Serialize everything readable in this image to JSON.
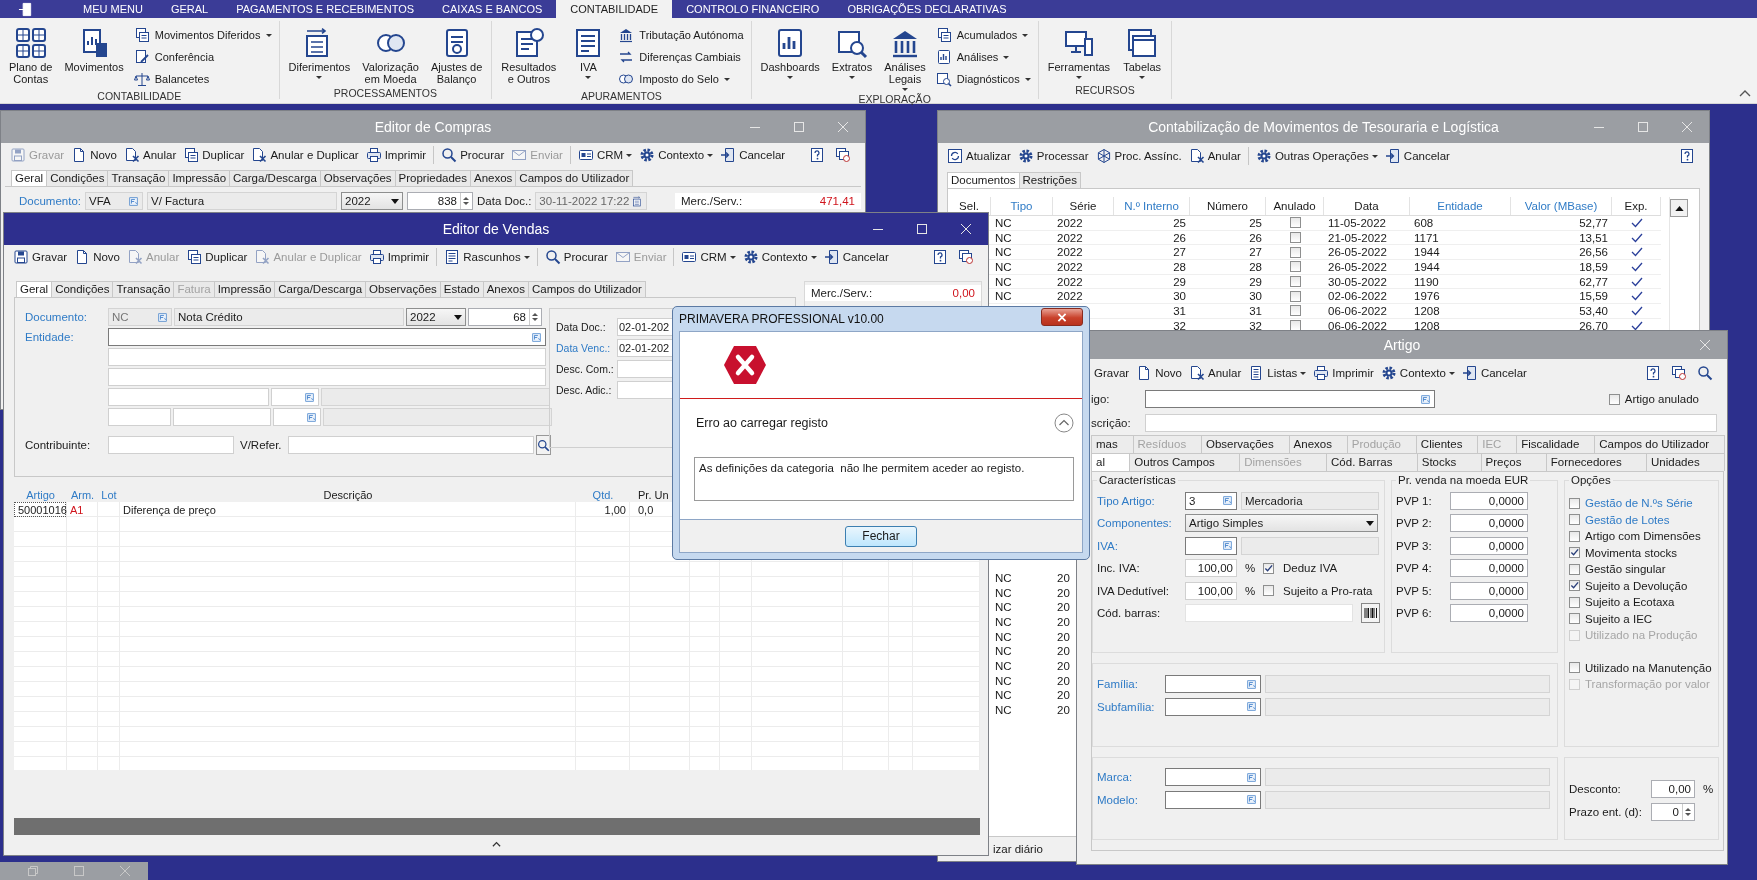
{
  "ribbon": {
    "tabs": [
      {
        "label": "MEU MENU",
        "selected": false
      },
      {
        "label": "GERAL",
        "selected": false
      },
      {
        "label": "PAGAMENTOS E RECEBIMENTOS",
        "selected": false
      },
      {
        "label": "CAIXAS E BANCOS",
        "selected": false
      },
      {
        "label": "CONTABILIDADE",
        "selected": true
      },
      {
        "label": "CONTROLO FINANCEIRO",
        "selected": false
      },
      {
        "label": "OBRIGAÇÕES DECLARATIVAS",
        "selected": false
      }
    ],
    "groups": [
      {
        "label": "CONTABILIDADE",
        "items": [
          {
            "kind": "large",
            "label": "Plano de\nContas",
            "dropdown": false
          },
          {
            "kind": "large",
            "label": "Movimentos",
            "dropdown": false
          },
          {
            "kind": "stack",
            "items": [
              {
                "label": "Movimentos Diferidos",
                "dropdown": true
              },
              {
                "label": "Conferência",
                "dropdown": false
              },
              {
                "label": "Balancetes",
                "dropdown": false
              }
            ]
          }
        ]
      },
      {
        "label": "PROCESSAMENTOS",
        "items": [
          {
            "kind": "large",
            "label": "Diferimentos",
            "dropdown": true
          },
          {
            "kind": "large",
            "label": "Valorização\nem Moeda",
            "dropdown": false
          },
          {
            "kind": "large",
            "label": "Ajustes de\nBalanço",
            "dropdown": false
          }
        ]
      },
      {
        "label": "APURAMENTOS",
        "items": [
          {
            "kind": "large",
            "label": "Resultados\ne Outros",
            "dropdown": false
          },
          {
            "kind": "large",
            "label": "IVA",
            "dropdown": true
          },
          {
            "kind": "stack",
            "items": [
              {
                "label": "Tributação Autónoma",
                "dropdown": false
              },
              {
                "label": "Diferenças Cambiais",
                "dropdown": false
              },
              {
                "label": "Imposto do Selo",
                "dropdown": true
              }
            ]
          }
        ]
      },
      {
        "label": "EXPLORAÇÃO",
        "items": [
          {
            "kind": "large",
            "label": "Dashboards",
            "dropdown": true
          },
          {
            "kind": "large",
            "label": "Extratos",
            "dropdown": true
          },
          {
            "kind": "large",
            "label": "Análises\nLegais",
            "dropdown": true
          },
          {
            "kind": "stack",
            "items": [
              {
                "label": "Acumulados",
                "dropdown": true
              },
              {
                "label": "Análises",
                "dropdown": true
              },
              {
                "label": "Diagnósticos",
                "dropdown": true
              }
            ]
          }
        ]
      },
      {
        "label": "RECURSOS",
        "items": [
          {
            "kind": "large",
            "label": "Ferramentas",
            "dropdown": true
          },
          {
            "kind": "large",
            "label": "Tabelas",
            "dropdown": true
          }
        ]
      }
    ]
  },
  "editor_compras": {
    "title": "Editor de Compras",
    "active": false,
    "toolbar": [
      [
        {
          "label": "Gravar",
          "disabled": true,
          "dropdown": false
        },
        {
          "label": "Novo",
          "disabled": false,
          "dropdown": false
        },
        {
          "label": "Anular",
          "disabled": false,
          "dropdown": false
        },
        {
          "label": "Duplicar",
          "disabled": false,
          "dropdown": false
        },
        {
          "label": "Anular e Duplicar",
          "disabled": false,
          "dropdown": false
        },
        {
          "label": "Imprimir",
          "disabled": false,
          "dropdown": false
        }
      ],
      [
        {
          "label": "Procurar",
          "disabled": false,
          "dropdown": false
        },
        {
          "label": "Enviar",
          "disabled": true,
          "dropdown": false
        }
      ],
      [
        {
          "label": "CRM",
          "disabled": false,
          "dropdown": true
        },
        {
          "label": "Contexto",
          "disabled": false,
          "dropdown": true
        },
        {
          "label": "Cancelar",
          "disabled": false,
          "dropdown": false
        }
      ]
    ],
    "tabs": [
      {
        "label": "Geral",
        "selected": true
      },
      {
        "label": "Condições",
        "selected": false
      },
      {
        "label": "Transação",
        "selected": false
      },
      {
        "label": "Impressão",
        "selected": false
      },
      {
        "label": "Carga/Descarga",
        "selected": false
      },
      {
        "label": "Observações",
        "selected": false
      },
      {
        "label": "Propriedades",
        "selected": false
      },
      {
        "label": "Anexos",
        "selected": false
      },
      {
        "label": "Campos do Utilizador",
        "selected": false
      }
    ],
    "document": {
      "label": "Documento:",
      "code": "VFA",
      "name": "V/ Factura",
      "year": "2022",
      "number": "838",
      "date_label": "Data Doc.:",
      "date": "30-11-2022 17:22"
    },
    "totals": [
      {
        "label": "Merc./Serv.:",
        "value": "471,41"
      }
    ]
  },
  "contabilizacao": {
    "title": "Contabilização de Movimentos de Tesouraria e Logística",
    "active": false,
    "toolbar": [
      [
        {
          "label": "Atualizar",
          "disabled": false,
          "dropdown": false
        },
        {
          "label": "Processar",
          "disabled": false,
          "dropdown": false
        },
        {
          "label": "Proc. Assínc.",
          "disabled": false,
          "dropdown": false
        },
        {
          "label": "Anular",
          "disabled": false,
          "dropdown": false
        }
      ],
      [
        {
          "label": "Outras Operações",
          "disabled": false,
          "dropdown": true
        },
        {
          "label": "Cancelar",
          "disabled": false,
          "dropdown": false
        }
      ]
    ],
    "tabs": [
      {
        "label": "Documentos",
        "selected": true
      },
      {
        "label": "Restrições",
        "selected": false
      }
    ],
    "columns": [
      {
        "label": "Sel.",
        "link": false
      },
      {
        "label": "Tipo",
        "link": true
      },
      {
        "label": "Série",
        "link": false
      },
      {
        "label": "N.º Interno",
        "link": true
      },
      {
        "label": "Número",
        "link": false
      },
      {
        "label": "Anulado",
        "link": false
      },
      {
        "label": "Data",
        "link": false
      },
      {
        "label": "Entidade",
        "link": true
      },
      {
        "label": "Valor (MBase)",
        "link": true
      },
      {
        "label": "Exp.",
        "link": false
      }
    ],
    "rows": [
      {
        "tipo": "NC",
        "serie": "2022",
        "n_interno": "25",
        "numero": "25",
        "anulado": false,
        "data": "11-05-2022",
        "entidade": "608",
        "valor": "52,77",
        "exp": true
      },
      {
        "tipo": "NC",
        "serie": "2022",
        "n_interno": "26",
        "numero": "26",
        "anulado": false,
        "data": "21-05-2022",
        "entidade": "1171",
        "valor": "13,51",
        "exp": true
      },
      {
        "tipo": "NC",
        "serie": "2022",
        "n_interno": "27",
        "numero": "27",
        "anulado": false,
        "data": "26-05-2022",
        "entidade": "1944",
        "valor": "26,56",
        "exp": true
      },
      {
        "tipo": "NC",
        "serie": "2022",
        "n_interno": "28",
        "numero": "28",
        "anulado": false,
        "data": "26-05-2022",
        "entidade": "1944",
        "valor": "18,59",
        "exp": true
      },
      {
        "tipo": "NC",
        "serie": "2022",
        "n_interno": "29",
        "numero": "29",
        "anulado": false,
        "data": "30-05-2022",
        "entidade": "1190",
        "valor": "62,77",
        "exp": true
      },
      {
        "tipo": "NC",
        "serie": "2022",
        "n_interno": "30",
        "numero": "30",
        "anulado": false,
        "data": "02-06-2022",
        "entidade": "1976",
        "valor": "15,59",
        "exp": true
      },
      {
        "n_interno": "31",
        "numero": "31",
        "anulado": false,
        "data": "06-06-2022",
        "entidade": "1208",
        "valor": "53,40",
        "exp": true
      },
      {
        "n_interno": "32",
        "numero": "32",
        "anulado": false,
        "data": "06-06-2022",
        "entidade": "1208",
        "valor": "26,70",
        "exp": true
      }
    ],
    "partial_rows": [
      {
        "tipo": "NC",
        "serie": "20"
      },
      {
        "tipo": "NC",
        "serie": "20"
      },
      {
        "tipo": "NC",
        "serie": "20"
      },
      {
        "tipo": "NC",
        "serie": "20"
      },
      {
        "tipo": "NC",
        "serie": "20"
      },
      {
        "tipo": "NC",
        "serie": "20"
      },
      {
        "tipo": "NC",
        "serie": "20"
      },
      {
        "tipo": "NC",
        "serie": "20"
      },
      {
        "tipo": "NC",
        "serie": "20"
      },
      {
        "tipo": "NC",
        "serie": "20"
      }
    ],
    "footer": "izar diário"
  },
  "editor_vendas": {
    "title": "Editor de Vendas",
    "active": true,
    "toolbar": [
      [
        {
          "label": "Gravar",
          "disabled": false,
          "dropdown": false
        },
        {
          "label": "Novo",
          "disabled": false,
          "dropdown": false
        },
        {
          "label": "Anular",
          "disabled": true,
          "dropdown": false
        },
        {
          "label": "Duplicar",
          "disabled": false,
          "dropdown": false
        },
        {
          "label": "Anular e Duplicar",
          "disabled": true,
          "dropdown": false
        },
        {
          "label": "Imprimir",
          "disabled": false,
          "dropdown": false
        }
      ],
      [
        {
          "label": "Rascunhos",
          "disabled": false,
          "dropdown": true
        }
      ],
      [
        {
          "label": "Procurar",
          "disabled": false,
          "dropdown": false
        },
        {
          "label": "Enviar",
          "disabled": true,
          "dropdown": false
        }
      ],
      [
        {
          "label": "CRM",
          "disabled": false,
          "dropdown": true
        },
        {
          "label": "Contexto",
          "disabled": false,
          "dropdown": true
        },
        {
          "label": "Cancelar",
          "disabled": false,
          "dropdown": false
        }
      ]
    ],
    "tabs": [
      {
        "label": "Geral",
        "selected": true,
        "disabled": false
      },
      {
        "label": "Condições",
        "selected": false,
        "disabled": false
      },
      {
        "label": "Transação",
        "selected": false,
        "disabled": false
      },
      {
        "label": "Fatura",
        "selected": false,
        "disabled": true
      },
      {
        "label": "Impressão",
        "selected": false,
        "disabled": false
      },
      {
        "label": "Carga/Descarga",
        "selected": false,
        "disabled": false
      },
      {
        "label": "Observações",
        "selected": false,
        "disabled": false
      },
      {
        "label": "Estado",
        "selected": false,
        "disabled": false
      },
      {
        "label": "Anexos",
        "selected": false,
        "disabled": false
      },
      {
        "label": "Campos do Utilizador",
        "selected": false,
        "disabled": false
      }
    ],
    "document": {
      "label": "Documento:",
      "code": "NC",
      "name": "Nota Crédito",
      "year": "2022",
      "number": "68"
    },
    "entity_label": "Entidade:",
    "taxpayer_label": "Contribuinte:",
    "reference_label": "V/Refer.",
    "date_fields": [
      {
        "label": "Data Doc.:",
        "value": "02-01-202",
        "link": false
      },
      {
        "label": "Data Venc.:",
        "value": "02-01-202",
        "link": true
      },
      {
        "label": "Desc. Com.:",
        "link": false
      },
      {
        "label": "Desc. Adic.:",
        "link": false
      }
    ],
    "totals": [
      {
        "label": "Merc./Serv.:",
        "value": "0,00"
      }
    ],
    "grid": {
      "columns": [
        {
          "label": "Artigo",
          "link": true
        },
        {
          "label": "Arm.",
          "link": true
        },
        {
          "label": "Lot",
          "link": true
        },
        {
          "label": "Descrição",
          "link": false
        },
        {
          "label": "Qtd.",
          "link": true
        },
        {
          "label": "Pr. Un",
          "link": false
        }
      ],
      "rows": [
        {
          "artigo": "50001016",
          "arm": "A1",
          "descricao": "Diferença de preço",
          "qtd": "1,00",
          "pr_un": "0,0"
        }
      ]
    }
  },
  "artigo": {
    "title": "Artigo",
    "active": false,
    "toolbar": [
      [
        {
          "label": "Gravar",
          "disabled": false,
          "dropdown": false
        },
        {
          "label": "Novo",
          "disabled": false,
          "dropdown": false
        },
        {
          "label": "Anular",
          "disabled": false,
          "dropdown": false
        },
        {
          "label": "Listas",
          "disabled": false,
          "dropdown": true
        },
        {
          "label": "Imprimir",
          "disabled": false,
          "dropdown": false
        },
        {
          "label": "Contexto",
          "disabled": false,
          "dropdown": true
        },
        {
          "label": "Cancelar",
          "disabled": false,
          "dropdown": false
        }
      ]
    ],
    "code_label": "igo:",
    "description_label": "scrição:",
    "cancelled": {
      "label": "Artigo anulado",
      "checked": false
    },
    "tabs_top": [
      {
        "label": "mas",
        "selected": false,
        "disabled": false
      },
      {
        "label": "Resíduos",
        "selected": false,
        "disabled": true
      },
      {
        "label": "Observações",
        "selected": false,
        "disabled": false
      },
      {
        "label": "Anexos",
        "selected": false,
        "disabled": false
      },
      {
        "label": "Produção",
        "selected": false,
        "disabled": true
      },
      {
        "label": "Clientes",
        "selected": false,
        "disabled": false
      },
      {
        "label": "IEC",
        "selected": false,
        "disabled": true
      },
      {
        "label": "Fiscalidade",
        "selected": false,
        "disabled": false
      },
      {
        "label": "Campos do Utilizador",
        "selected": false,
        "disabled": false
      }
    ],
    "tabs_bottom": [
      {
        "label": "al",
        "selected": true,
        "disabled": false
      },
      {
        "label": "Outros Campos",
        "selected": false,
        "disabled": false
      },
      {
        "label": "Dimensões",
        "selected": false,
        "disabled": true
      },
      {
        "label": "Cód. Barras",
        "selected": false,
        "disabled": false
      },
      {
        "label": "Stocks",
        "selected": false,
        "disabled": false
      },
      {
        "label": "Preços",
        "selected": false,
        "disabled": false
      },
      {
        "label": "Fornecedores",
        "selected": false,
        "disabled": false
      },
      {
        "label": "Unidades",
        "selected": false,
        "disabled": false
      }
    ],
    "features": {
      "title": "Características",
      "type_label": "Tipo Artigo:",
      "type_code": "3",
      "type_name": "Mercadoria",
      "components_label": "Componentes:",
      "components": "Artigo Simples",
      "vat_label": "IVA:",
      "inc_vat_label": "Inc. IVA:",
      "inc_vat": "100,00",
      "inc_vat_unit": "%",
      "deduct": {
        "label": "Deduz IVA",
        "checked": true
      },
      "deductible_label": "IVA Dedutível:",
      "deductible": "100,00",
      "deductible_unit": "%",
      "pro_rata": {
        "label": "Sujeito a Pro-rata",
        "checked": false
      },
      "barcode_label": "Cód. barras:"
    },
    "prices": {
      "title": "Pr. venda na moeda EUR",
      "items": [
        {
          "label": "PVP 1:",
          "value": "0,0000"
        },
        {
          "label": "PVP 2:",
          "value": "0,0000"
        },
        {
          "label": "PVP 3:",
          "value": "0,0000"
        },
        {
          "label": "PVP 4:",
          "value": "0,0000"
        },
        {
          "label": "PVP 5:",
          "value": "0,0000"
        },
        {
          "label": "PVP 6:",
          "value": "0,0000"
        }
      ]
    },
    "options": {
      "title": "Opções",
      "groups": [
        [
          {
            "label": "Gestão de N.ºs Série",
            "checked": false,
            "disabled": false,
            "link": true
          },
          {
            "label": "Gestão de Lotes",
            "checked": false,
            "disabled": false,
            "link": true
          },
          {
            "label": "Artigo com Dimensões",
            "checked": false,
            "disabled": false,
            "link": false
          },
          {
            "label": "Movimenta stocks",
            "checked": true,
            "disabled": false,
            "link": false
          },
          {
            "label": "Gestão singular",
            "checked": false,
            "disabled": false,
            "link": false
          },
          {
            "label": "Sujeito a Devolução",
            "checked": true,
            "disabled": false,
            "link": false
          },
          {
            "label": "Sujeito a Ecotaxa",
            "checked": false,
            "disabled": false,
            "link": false
          },
          {
            "label": "Sujeito a IEC",
            "checked": false,
            "disabled": false,
            "link": false
          },
          {
            "label": "Utilizado na Produção",
            "checked": false,
            "disabled": true,
            "link": false
          }
        ],
        [
          {
            "label": "Utilizado na Manutenção",
            "checked": false,
            "disabled": false,
            "link": false
          },
          {
            "label": "Transformação por valor",
            "checked": false,
            "disabled": true,
            "link": false
          }
        ]
      ]
    },
    "classification": [
      [
        "Família:",
        "Subfamília:"
      ],
      [
        "Marca:",
        "Modelo:"
      ]
    ],
    "discount": {
      "label": "Desconto:",
      "value": "0,00",
      "unit": "%"
    },
    "delivery": {
      "label": "Prazo ent. (d):",
      "value": "0"
    }
  },
  "dialog": {
    "title": "PRIMAVERA PROFESSIONAL v10.00",
    "heading": "Erro ao carregar registo",
    "message": "As definições da categoria  não lhe permitem aceder ao registo.",
    "button": "Fechar"
  }
}
